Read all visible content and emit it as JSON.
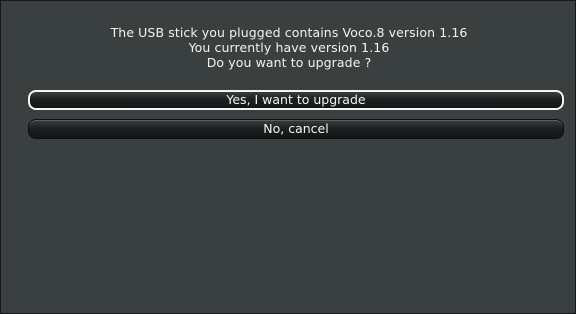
{
  "dialog": {
    "message_lines": [
      "The USB stick you plugged contains Voco.8 version 1.16",
      "You currently have version 1.16",
      "Do you want to upgrade ?"
    ],
    "confirm_label": "Yes, I want to upgrade",
    "cancel_label": "No, cancel"
  },
  "colors": {
    "background": "#3a3f40",
    "text": "#f2f2f2",
    "selected_border": "#f4f4f4"
  }
}
